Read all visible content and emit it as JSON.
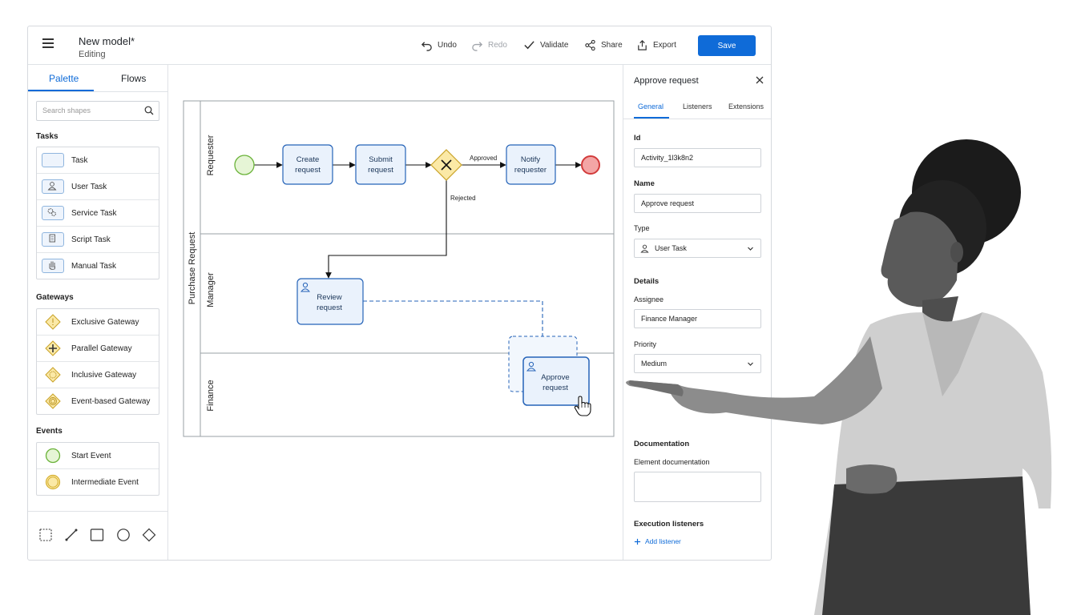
{
  "header": {
    "title": "New model*",
    "subtitle": "Editing",
    "undo": "Undo",
    "redo": "Redo",
    "validate": "Validate",
    "share": "Share",
    "export": "Export",
    "save": "Save"
  },
  "palette": {
    "tabs": [
      "Palette",
      "Flows"
    ],
    "search_placeholder": "Search shapes",
    "sections": {
      "tasks": "Tasks",
      "gateways": "Gateways",
      "events": "Events"
    },
    "tasks": [
      "Task",
      "User Task",
      "Service Task",
      "Script Task",
      "Manual Task"
    ],
    "gateways": [
      "Exclusive Gateway",
      "Parallel Gateway",
      "Inclusive Gateway",
      "Event-based Gateway"
    ],
    "events": [
      "Start Event",
      "Intermediate Event"
    ]
  },
  "diagram": {
    "pool": "Purchase Request",
    "lanes": [
      "Requester",
      "Manager",
      "Finance"
    ],
    "tasks": {
      "create": [
        "Create",
        "request"
      ],
      "submit": [
        "Submit",
        "request"
      ],
      "notify": [
        "Notify",
        "requester"
      ],
      "review": [
        "Review",
        "request"
      ],
      "approve": [
        "Approve",
        "request"
      ]
    },
    "flows": {
      "approved": "Approved",
      "rejected": "Rejected"
    }
  },
  "properties": {
    "title": "Approve request",
    "tabs": [
      "General",
      "Listeners",
      "Extensions"
    ],
    "id_label": "Id",
    "id_value": "Activity_1l3k8n2",
    "name_label": "Name",
    "name_value": "Approve request",
    "type_label": "Type",
    "type_value": "User Task",
    "details_label": "Details",
    "assignee_label": "Assignee",
    "assignee_value": "Finance Manager",
    "priority_label": "Priority",
    "priority_value": "Medium",
    "documentation_label": "Documentation",
    "element_doc_label": "Element documentation",
    "exec_listeners_label": "Execution listeners",
    "add_listener": "Add listener"
  },
  "colors": {
    "accent": "#0f6bd8",
    "task_fill": "#eaf2fc",
    "task_stroke": "#2563b8",
    "gateway_fill": "#fbe9a6",
    "gateway_stroke": "#c9a227",
    "start_fill": "#e6f5d6",
    "start_stroke": "#6bb33a",
    "end_fill": "#f3a5a5",
    "end_stroke": "#d23b3b"
  }
}
